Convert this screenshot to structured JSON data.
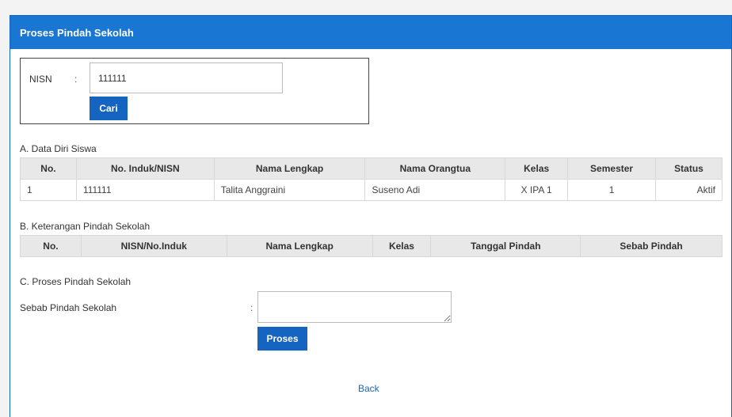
{
  "header": {
    "title": "Proses Pindah Sekolah"
  },
  "search": {
    "nisn_label": "NISN",
    "colon": ":",
    "nisn_value": "111111",
    "cari_label": "Cari"
  },
  "section_a": {
    "title": "A. Data Diri Siswa",
    "columns": [
      "No.",
      "No. Induk/NISN",
      "Nama Lengkap",
      "Nama Orangtua",
      "Kelas",
      "Semester",
      "Status"
    ],
    "rows": [
      [
        "1",
        "111111",
        "Talita Anggraini",
        "Suseno Adi",
        "X IPA 1",
        "1",
        "Aktif"
      ]
    ]
  },
  "section_b": {
    "title": "B. Keterangan Pindah Sekolah",
    "columns": [
      "No.",
      "NISN/No.Induk",
      "Nama Lengkap",
      "Kelas",
      "Tanggal Pindah",
      "Sebab Pindah"
    ]
  },
  "section_c": {
    "title": "C. Proses Pindah Sekolah",
    "sebab_label": "Sebab Pindah Sekolah",
    "colon": ":",
    "sebab_value": "",
    "proses_label": "Proses"
  },
  "footer": {
    "back_label": "Back"
  },
  "colors": {
    "primary": "#1976d2",
    "button": "#1565c0",
    "table_header_bg": "#e8e8e8"
  }
}
